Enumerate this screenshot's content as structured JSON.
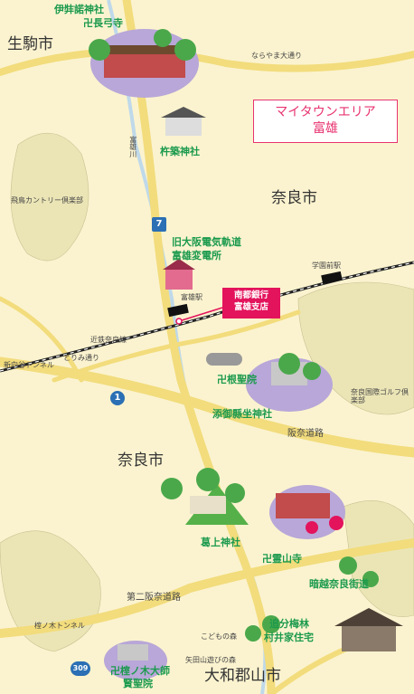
{
  "title": {
    "line1": "マイタウンエリア",
    "line2": "富雄"
  },
  "bank": {
    "line1": "南都銀行",
    "line2": "富雄支店"
  },
  "cities": {
    "ikoma": "生駒市",
    "nara_north": "奈良市",
    "nara_south": "奈良市",
    "yamatokoriyama": "大和郡山市"
  },
  "landmarks": {
    "izanagi": "伊弉諾神社",
    "chokyuji": "卍長弓寺",
    "kinetsu": "杵築神社",
    "old_substation_1": "旧大阪電気軌道",
    "old_substation_2": "富雄変電所",
    "nejoin": "卍根聖院",
    "soumimata": "添御縣坐神社",
    "kazurakami": "葛上神社",
    "reizanji": "卍霊山寺",
    "oiwake": "追分梅林",
    "murai": "村井家住宅",
    "hinoki": "卍榁ノ木大師",
    "kenshoin": "賢聖院"
  },
  "places": {
    "asuka_golf": "飛鳥カントリー倶楽部",
    "nara_golf": "奈良国際ゴルフ倶楽部",
    "kodomo": "こどもの森",
    "yatayama": "矢田山遊びの森",
    "tomio_river": "富雄川"
  },
  "roads": {
    "narayama": "ならやま大通り",
    "tomiyama": "とりみ通り",
    "hanna": "阪奈道路",
    "daini_hanna": "第二阪奈道路",
    "kurakai": "暗越奈良街道",
    "shin_ikoma_tunnel": "新向谷トンネル",
    "muro_tunnel": "榁ノ木トンネル"
  },
  "rail": {
    "kintetsu": "近鉄奈良線",
    "tomio_station": "富雄駅",
    "gakuenmae_station": "学園前駅"
  },
  "route_numbers": {
    "r7": "7",
    "r1": "1",
    "r309": "309"
  },
  "colors": {
    "background": "#fbf3cf",
    "road": "#f2dc7c",
    "river": "#bfd9ea",
    "green_label": "#1b9a4d",
    "accent": "#e3135c",
    "title": "#e8336f"
  }
}
